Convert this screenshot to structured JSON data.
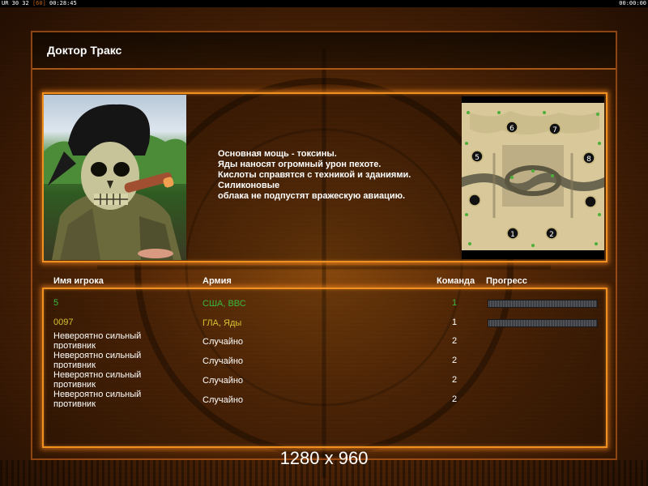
{
  "status_bar": {
    "left_text": "UR 30 32",
    "left_dim": "[60]",
    "left_time": "00:28:45",
    "right_time": "00:00:00"
  },
  "title": "Доктор Тракс",
  "description_lines": [
    "Основная мощь - токсины.",
    "Яды наносят огромный урон пехоте.",
    "Кислоты справятся с техникой и зданиями.",
    "Силиконовые",
    "облака не подпустят вражескую авиацию."
  ],
  "minimap": {
    "start_positions": [
      "6",
      "7",
      "5",
      "8",
      "1",
      "2"
    ]
  },
  "table": {
    "headers": {
      "player": "Имя игрока",
      "army": "Армия",
      "team": "Команда",
      "progress": "Прогресс"
    },
    "rows": [
      {
        "name": "5",
        "army": "США, ВВС",
        "team": "1",
        "color": "#3ab83a",
        "progress": 1.0
      },
      {
        "name": "0097",
        "army": "ГЛА, Яды",
        "team": "1",
        "color": "#d8c230",
        "progress": 1.0
      },
      {
        "name": "Невероятно сильный противник",
        "army": "Случайно",
        "team": "2",
        "color": "#ffffff"
      },
      {
        "name": "Невероятно сильный противник",
        "army": "Случайно",
        "team": "2",
        "color": "#ffffff"
      },
      {
        "name": "Невероятно сильный противник",
        "army": "Случайно",
        "team": "2",
        "color": "#ffffff"
      },
      {
        "name": "Невероятно сильный противник",
        "army": "Случайно",
        "team": "2",
        "color": "#ffffff"
      }
    ]
  },
  "resolution": "1280 x 960"
}
